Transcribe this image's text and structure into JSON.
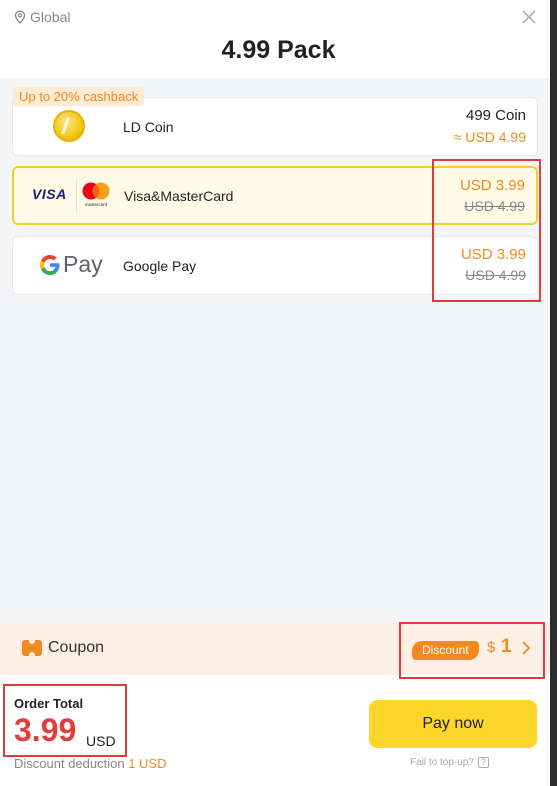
{
  "header": {
    "region": "Global",
    "title": "4.99 Pack"
  },
  "cashback_badge": "Up to 20% cashback",
  "payment_methods": [
    {
      "name": "LD Coin",
      "coin_amount": "499 Coin",
      "price_approx": "≈ USD 4.99",
      "icon": "coin-icon"
    },
    {
      "name": "Visa&MasterCard",
      "visa_text": "VISA",
      "mastercard_text": "mastercard",
      "price_now": "USD 3.99",
      "price_old": "USD 4.99",
      "selected": true
    },
    {
      "name": "Google Pay",
      "gpay_text": "Pay",
      "price_now": "USD 3.99",
      "price_old": "USD 4.99"
    }
  ],
  "coupon": {
    "label": "Coupon",
    "tag": "Discount",
    "currency_symbol": "$",
    "amount": "1"
  },
  "footer": {
    "order_label": "Order Total",
    "total": "3.99",
    "currency": "USD",
    "deduction_label": "Discount deduction",
    "deduction_value": "1 USD",
    "pay_button": "Pay now",
    "fail_link": "Fail to top-up?"
  },
  "colors": {
    "accent": "#f08a1f",
    "total_red": "#e43b3b",
    "pay_yellow": "#fcd62b",
    "selected_border": "#f7cd2e",
    "highlight_red": "#e03b3b"
  }
}
